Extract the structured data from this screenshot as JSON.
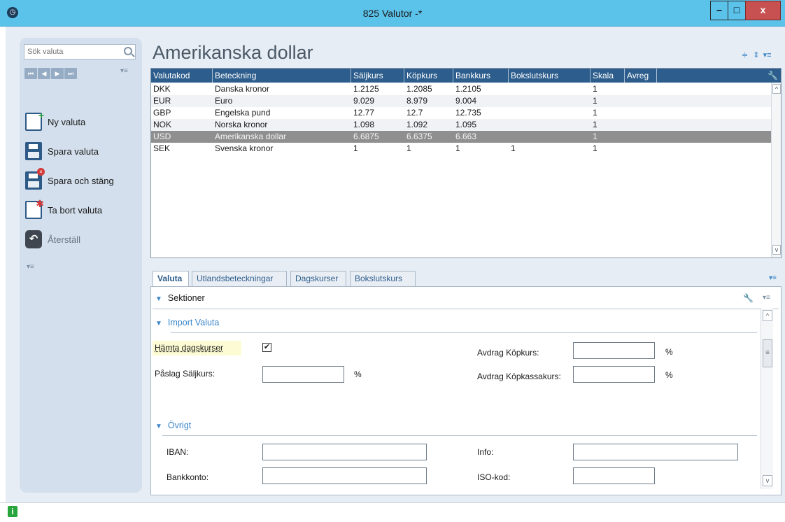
{
  "window": {
    "title": "825 Valutor -*"
  },
  "sidebar": {
    "search_placeholder": "Sök valuta",
    "nav_buttons": [
      "⏮",
      "◀",
      "▶",
      "⏭"
    ],
    "actions": [
      {
        "label": "Ny valuta",
        "icon": "new-document-icon",
        "enabled": true
      },
      {
        "label": "Spara valuta",
        "icon": "save-icon",
        "enabled": true
      },
      {
        "label": "Spara och stäng",
        "icon": "save-close-icon",
        "enabled": true
      },
      {
        "label": "Ta bort valuta",
        "icon": "delete-document-icon",
        "enabled": true
      },
      {
        "label": "Återställ",
        "icon": "undo-icon",
        "enabled": false
      }
    ]
  },
  "main": {
    "heading": "Amerikanska dollar",
    "grid": {
      "columns": [
        "Valutakod",
        "Beteckning",
        "Säljkurs",
        "Köpkurs",
        "Bankkurs",
        "Bokslutskurs",
        "Skala",
        "Avreg"
      ],
      "rows": [
        [
          "DKK",
          "Danska kronor",
          "1.2125",
          "1.2085",
          "1.2105",
          "",
          "1",
          ""
        ],
        [
          "EUR",
          "Euro",
          "9.029",
          "8.979",
          "9.004",
          "",
          "1",
          ""
        ],
        [
          "GBP",
          "Engelska pund",
          "12.77",
          "12.7",
          "12.735",
          "",
          "1",
          ""
        ],
        [
          "NOK",
          "Norska kronor",
          "1.098",
          "1.092",
          "1.095",
          "",
          "1",
          ""
        ],
        [
          "USD",
          "Amerikanska dollar",
          "6.6875",
          "6.6375",
          "6.663",
          "",
          "1",
          ""
        ],
        [
          "SEK",
          "Svenska kronor",
          "1",
          "1",
          "1",
          "1",
          "1",
          ""
        ]
      ],
      "selected_row": "USD"
    },
    "tabs": [
      "Valuta",
      "Utlandsbeteckningar",
      "Dagskurser",
      "Bokslutskurs"
    ],
    "active_tab": "Valuta",
    "sections_label": "Sektioner",
    "import_section": {
      "title": "Import Valuta",
      "hamta_label": "Hämta dagskurser",
      "hamta_checked": "✔",
      "palag_label": "Påslag Säljkurs:",
      "palag_value": "",
      "palag_unit": "%",
      "avdrag_kop_label": "Avdrag Köpkurs:",
      "avdrag_kop_value": "",
      "avdrag_kop_unit": "%",
      "avdrag_kopkassa_label": "Avdrag Köpkassakurs:",
      "avdrag_kopkassa_value": "",
      "avdrag_kopkassa_unit": "%"
    },
    "other_section": {
      "title": "Övrigt",
      "iban_label": "IBAN:",
      "iban_value": "",
      "bankkonto_label": "Bankkonto:",
      "bankkonto_value": "",
      "info_label": "Info:",
      "info_value": "",
      "iso_label": "ISO-kod:",
      "iso_value": ""
    }
  },
  "colors": {
    "titlebar": "#5bc2ea",
    "grid_header": "#2d5d8c",
    "selected_row": "#8f8f8f",
    "accent": "#3a86c8",
    "sidebar": "#d3dfec"
  }
}
